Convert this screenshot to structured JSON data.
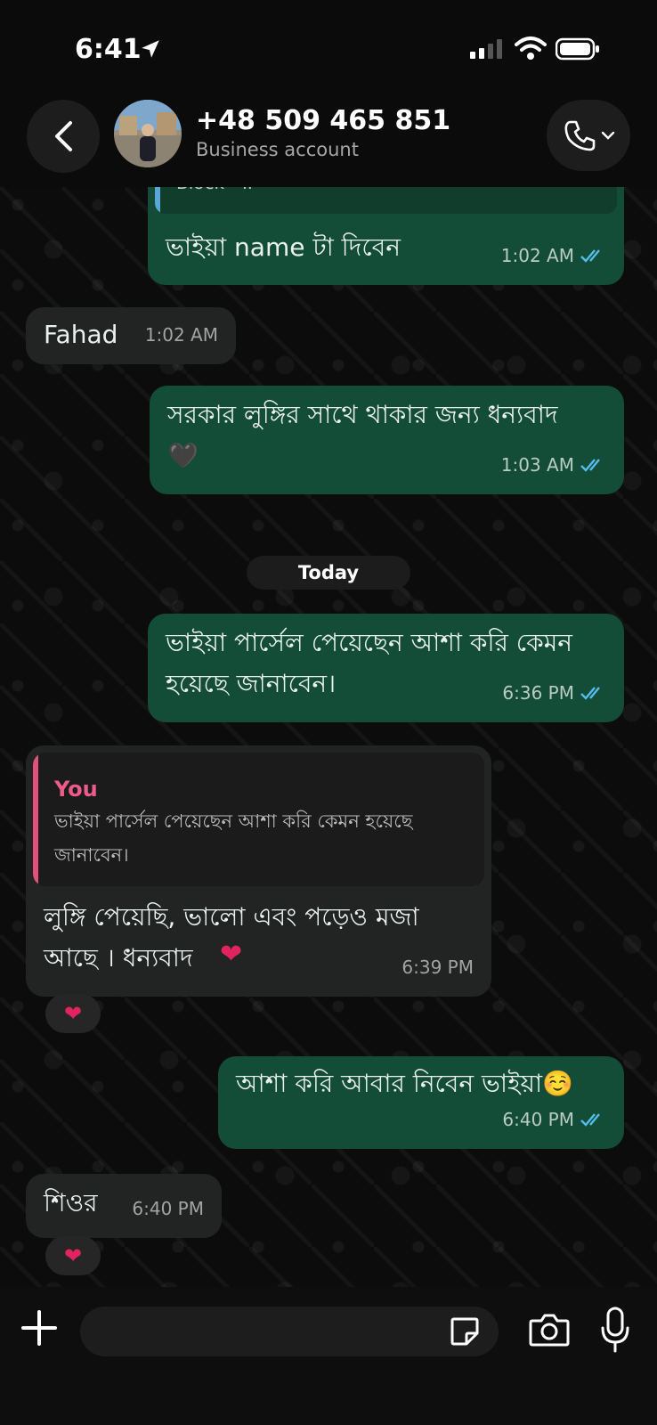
{
  "status_bar": {
    "time": "6:41"
  },
  "header": {
    "contact_name": "+48 509 465 851",
    "contact_subtitle": "Business account"
  },
  "messages": [
    {
      "quote_fragment": "Block - II",
      "text": "ভাইয়া name টা দিবেন",
      "time": "1:02 AM"
    },
    {
      "text": "Fahad",
      "time": "1:02 AM"
    },
    {
      "text_line1": "সরকার লুঙ্গির সাথে থাকার জন্য ধন্যবাদ",
      "text_line2": "🖤",
      "time": "1:03 AM"
    },
    {
      "text_line1": "ভাইয়া পার্সেল পেয়েছেন আশা করি কেমন",
      "text_line2": "হয়েছে জানাবেন।",
      "time": "6:36 PM"
    },
    {
      "quote_author": "You",
      "quote_text": "ভাইয়া পার্সেল পেয়েছেন আশা করি কেমন হয়েছে জানাবেন।",
      "text_line1": "লুঙ্গি পেয়েছি, ভালো এবং পড়েও মজা",
      "text_line2": "আছে । ধন্যবাদ",
      "time": "6:39 PM",
      "reaction": "❤"
    },
    {
      "text": "আশা করি আবার নিবেন ভাইয়া☺️",
      "time": "6:40 PM"
    },
    {
      "text": "শিওর",
      "time": "6:40 PM",
      "reaction": "❤"
    }
  ],
  "date_divider": "Today",
  "input": {
    "placeholder": ""
  },
  "colors": {
    "outgoing": "#144d37",
    "incoming": "#222323",
    "read_ticks": "#53bdeb",
    "reaction_heart": "#e0245e"
  }
}
